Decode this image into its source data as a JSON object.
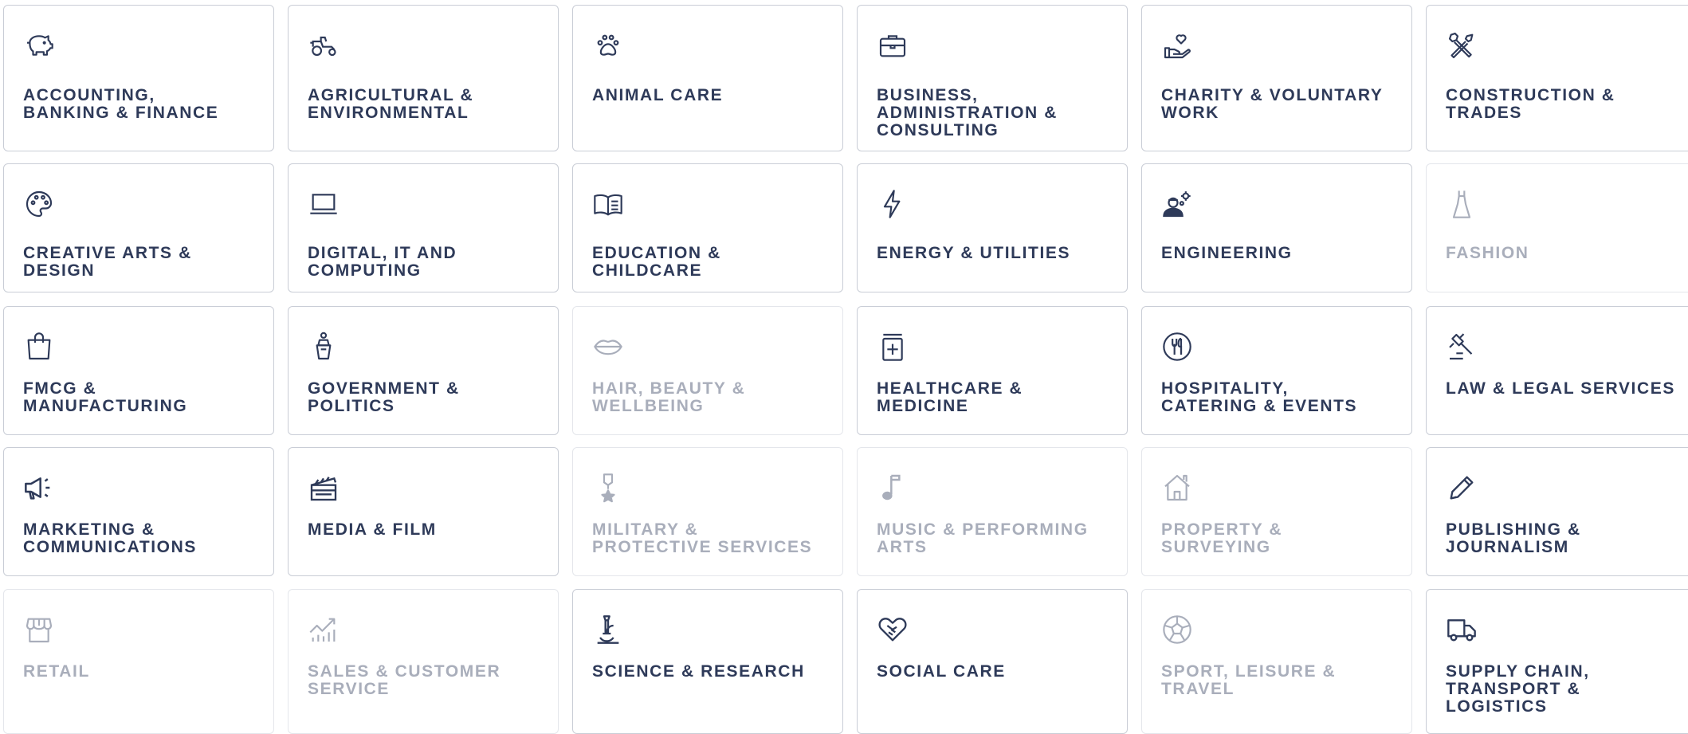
{
  "colors": {
    "active_text": "#2e3a59",
    "muted_text": "#a9aebb",
    "border": "#c9cdd6"
  },
  "categories": [
    {
      "label": "ACCOUNTING,\nBANKING & FINANCE",
      "icon": "piggy-bank-icon",
      "enabled": true
    },
    {
      "label": "AGRICULTURAL &\nENVIRONMENTAL",
      "icon": "tractor-icon",
      "enabled": true
    },
    {
      "label": "ANIMAL CARE",
      "icon": "paw-icon",
      "enabled": true
    },
    {
      "label": "BUSINESS,\nADMINISTRATION &\nCONSULTING",
      "icon": "briefcase-icon",
      "enabled": true
    },
    {
      "label": "CHARITY & VOLUNTARY\nWORK",
      "icon": "hand-heart-icon",
      "enabled": true
    },
    {
      "label": "CONSTRUCTION &\nTRADES",
      "icon": "hammer-wrench-icon",
      "enabled": true
    },
    {
      "label": "CREATIVE ARTS &\nDESIGN",
      "icon": "palette-icon",
      "enabled": true
    },
    {
      "label": "DIGITAL, IT AND\nCOMPUTING",
      "icon": "laptop-icon",
      "enabled": true
    },
    {
      "label": "EDUCATION &\nCHILDCARE",
      "icon": "open-book-icon",
      "enabled": true
    },
    {
      "label": "ENERGY & UTILITIES",
      "icon": "lightning-icon",
      "enabled": true
    },
    {
      "label": "ENGINEERING",
      "icon": "engineer-gear-icon",
      "enabled": true
    },
    {
      "label": "FASHION",
      "icon": "dress-icon",
      "enabled": false
    },
    {
      "label": "FMCG &\nMANUFACTURING",
      "icon": "shopping-bag-icon",
      "enabled": true
    },
    {
      "label": "GOVERNMENT &\nPOLITICS",
      "icon": "person-podium-icon",
      "enabled": true
    },
    {
      "label": "HAIR, BEAUTY &\nWELLBEING",
      "icon": "lips-icon",
      "enabled": false
    },
    {
      "label": "HEALTHCARE &\nMEDICINE",
      "icon": "medicine-box-icon",
      "enabled": true
    },
    {
      "label": "HOSPITALITY,\nCATERING & EVENTS",
      "icon": "cutlery-icon",
      "enabled": true
    },
    {
      "label": "LAW & LEGAL SERVICES",
      "icon": "gavel-icon",
      "enabled": true
    },
    {
      "label": "MARKETING &\nCOMMUNICATIONS",
      "icon": "megaphone-icon",
      "enabled": true
    },
    {
      "label": "MEDIA & FILM",
      "icon": "clapperboard-icon",
      "enabled": true
    },
    {
      "label": "MILITARY &\nPROTECTIVE SERVICES",
      "icon": "medal-icon",
      "enabled": false
    },
    {
      "label": "MUSIC & PERFORMING\nARTS",
      "icon": "music-note-icon",
      "enabled": false
    },
    {
      "label": "PROPERTY &\nSURVEYING",
      "icon": "house-icon",
      "enabled": false
    },
    {
      "label": "PUBLISHING &\nJOURNALISM",
      "icon": "pencil-icon",
      "enabled": true
    },
    {
      "label": "RETAIL",
      "icon": "storefront-icon",
      "enabled": false
    },
    {
      "label": "SALES & CUSTOMER\nSERVICE",
      "icon": "chart-growth-icon",
      "enabled": false
    },
    {
      "label": "SCIENCE & RESEARCH",
      "icon": "microscope-icon",
      "enabled": true
    },
    {
      "label": "SOCIAL CARE",
      "icon": "handshake-heart-icon",
      "enabled": true
    },
    {
      "label": "SPORT, LEISURE &\nTRAVEL",
      "icon": "football-icon",
      "enabled": false
    },
    {
      "label": "SUPPLY CHAIN,\nTRANSPORT &\nLOGISTICS",
      "icon": "truck-icon",
      "enabled": true
    }
  ]
}
